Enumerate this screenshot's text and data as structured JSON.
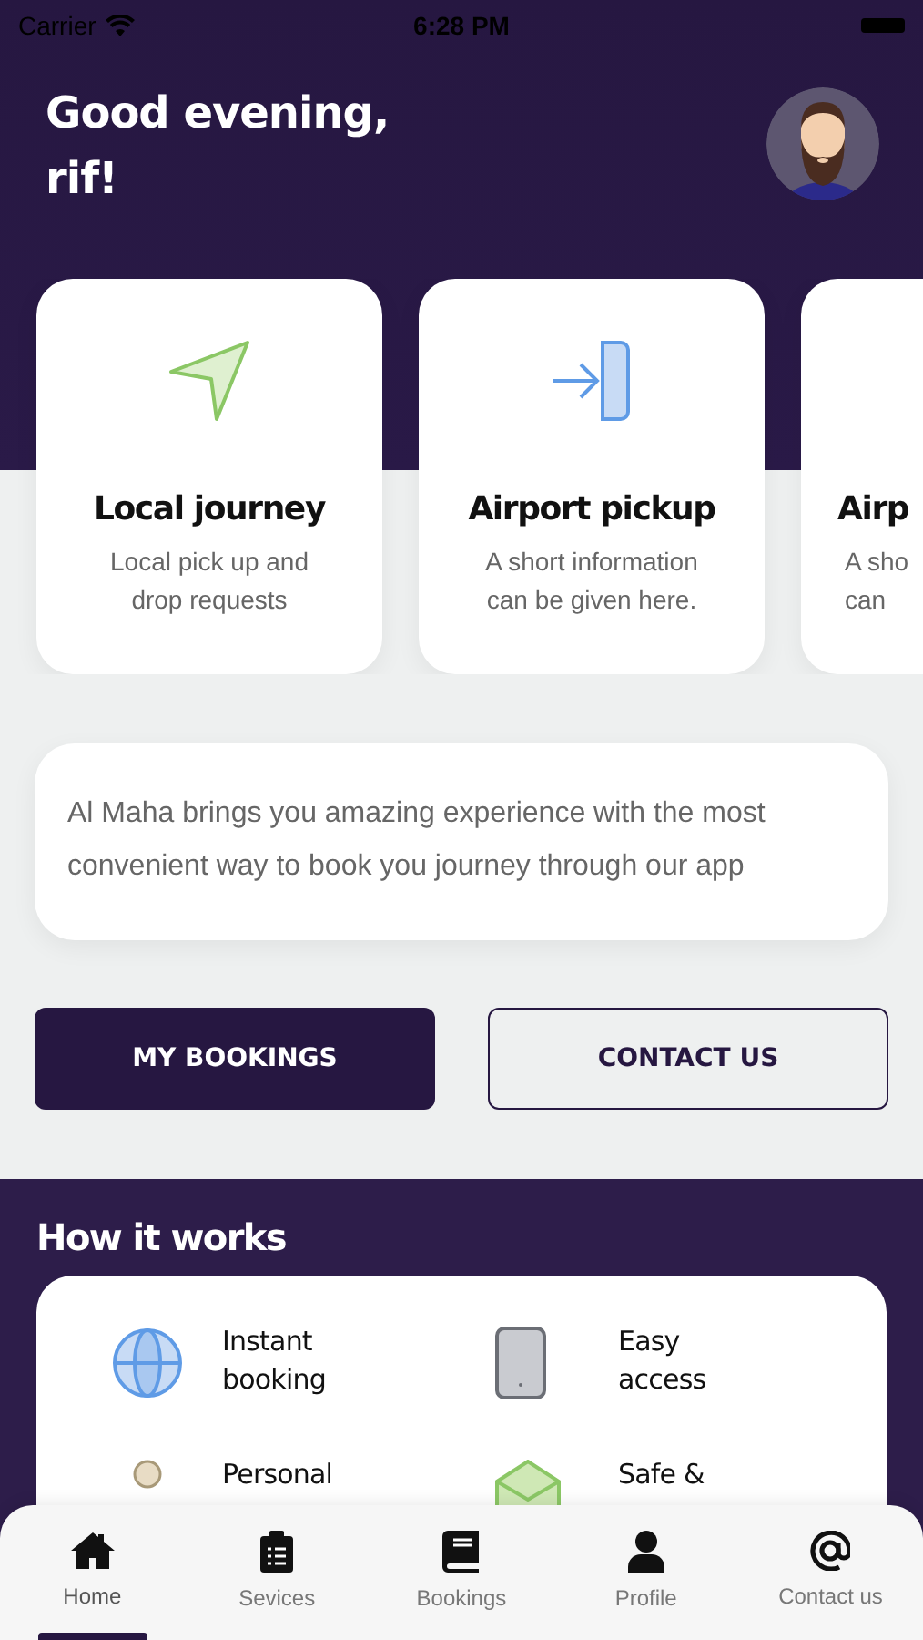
{
  "status_bar": {
    "carrier": "Carrier",
    "time": "6:28 PM"
  },
  "greeting": {
    "lines": [
      "Good evening,",
      "rif!"
    ]
  },
  "services": [
    {
      "title": "Local journey",
      "description": [
        "Local pick up and",
        "drop requests"
      ]
    },
    {
      "title": "Airport pickup",
      "description": [
        "A short information",
        "can be given here."
      ]
    },
    {
      "title": "Airp",
      "description": [
        "A sho",
        "can"
      ]
    }
  ],
  "info": "Al Maha brings you amazing experience with the most convenient way to book you journey through our app",
  "buttons": [
    {
      "label": "MY BOOKINGS",
      "kind": "primary"
    },
    {
      "label": "CONTACT US",
      "kind": "outline"
    }
  ],
  "how_it_works": {
    "title": "How it works",
    "items": [
      {
        "lines": [
          "Instant",
          "booking"
        ]
      },
      {
        "lines": [
          "Easy",
          "access"
        ]
      },
      {
        "lines": [
          "Personal"
        ]
      },
      {
        "lines": [
          "Safe &"
        ]
      }
    ]
  },
  "tab_bar": [
    {
      "label": "Home",
      "selected": true
    },
    {
      "label": "Sevices",
      "selected": false
    },
    {
      "label": "Bookings",
      "selected": false
    },
    {
      "label": "Profile",
      "selected": false
    },
    {
      "label": "Contact us",
      "selected": false
    }
  ]
}
